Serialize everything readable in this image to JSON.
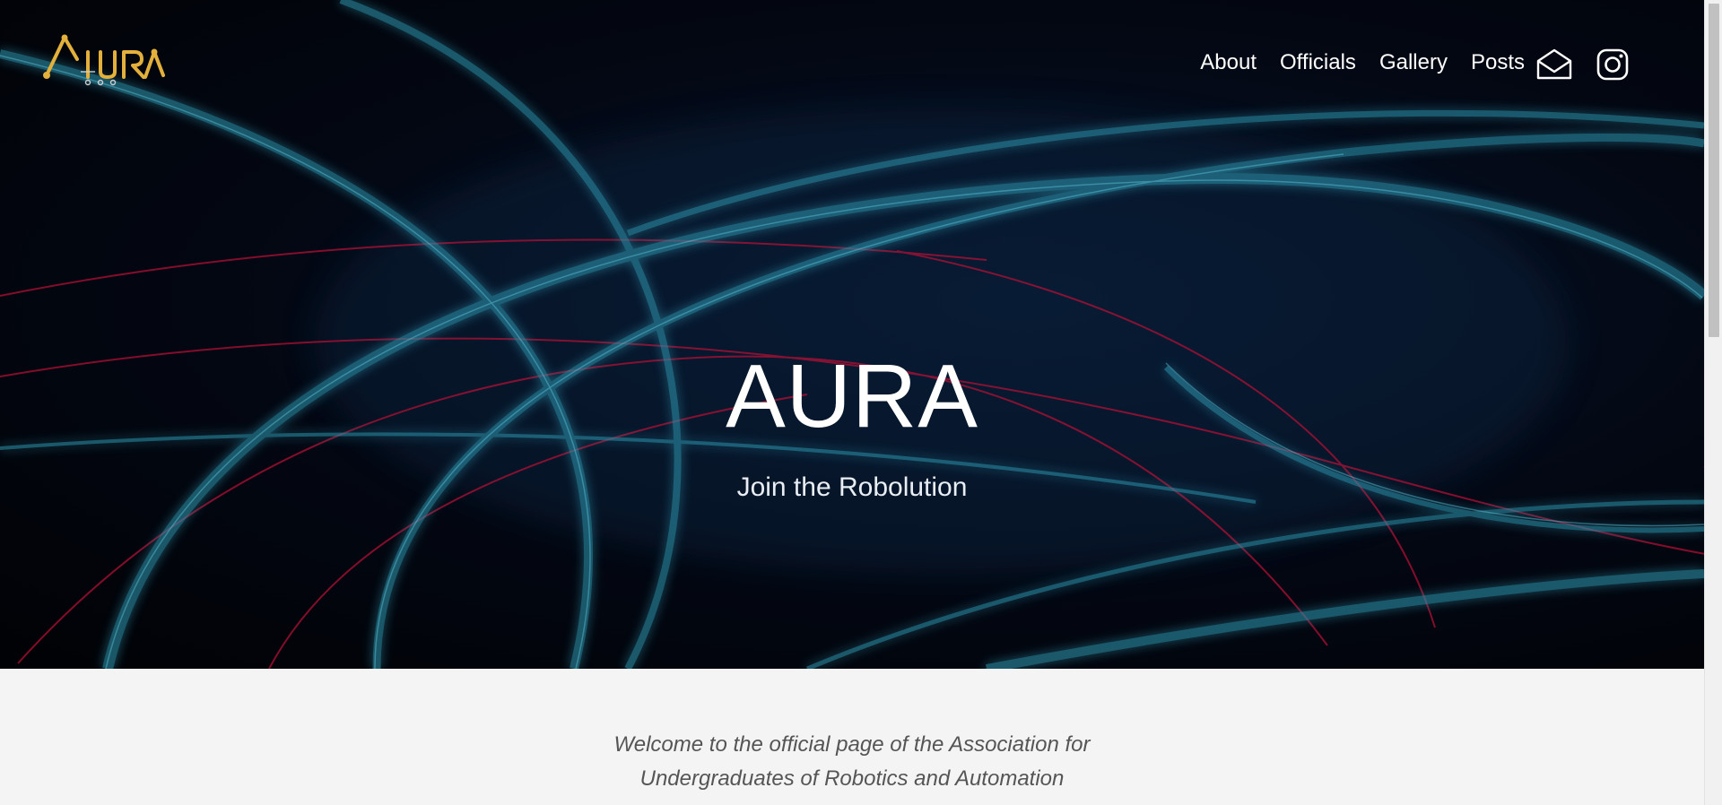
{
  "nav": {
    "items": [
      {
        "label": "About"
      },
      {
        "label": "Officials"
      },
      {
        "label": "Gallery"
      },
      {
        "label": "Posts"
      }
    ]
  },
  "social": {
    "mail_icon": "envelope-icon",
    "instagram_icon": "instagram-icon"
  },
  "logo": {
    "text": "AURA"
  },
  "hero": {
    "title": "AURA",
    "subtitle": "Join the Robolution"
  },
  "intro": {
    "line1": "Welcome to the official page of the Association for",
    "line2": "Undergraduates of Robotics and Automation"
  },
  "colors": {
    "accent_teal": "#2c8fa8",
    "accent_red": "#c4123c",
    "logo_gold": "#e3b13b"
  }
}
